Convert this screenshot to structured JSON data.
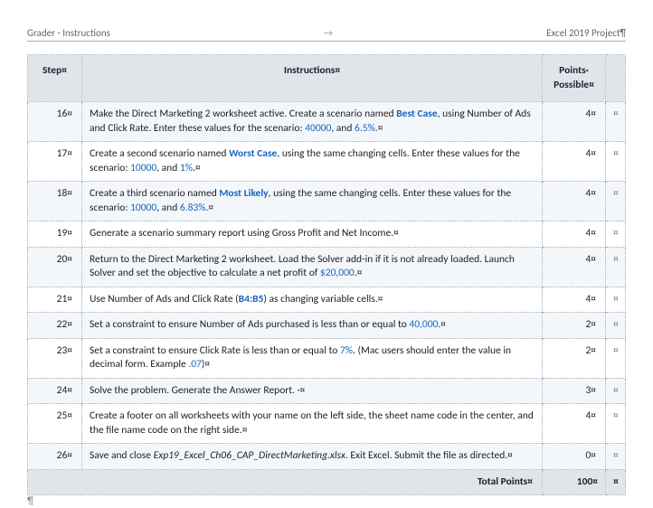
{
  "header": {
    "left": "Grader - Instructions",
    "center": "→",
    "right": "Excel 2019 Project¶"
  },
  "columns": {
    "step": "Step¤",
    "instructions": "Instructions¤",
    "points": "Points·\nPossible¤"
  },
  "marks": {
    "cell": "¤",
    "pilcrow": "¶"
  },
  "rows": [
    {
      "step": "16¤",
      "points": "4¤",
      "segs": [
        {
          "t": "Make the Direct Marketing 2 worksheet active. Create a scenario named "
        },
        {
          "t": "Best Case",
          "cls": "blue"
        },
        {
          "t": ", using Number of Ads and Click Rate. Enter these values for the scenario: "
        },
        {
          "t": "40000",
          "cls": "blue-plain"
        },
        {
          "t": ", and "
        },
        {
          "t": "6.5%",
          "cls": "blue-plain"
        },
        {
          "t": ".¤"
        }
      ]
    },
    {
      "step": "17¤",
      "points": "4¤",
      "segs": [
        {
          "t": "Create a second scenario named "
        },
        {
          "t": "Worst Case",
          "cls": "blue"
        },
        {
          "t": ", using the same changing cells. Enter these values for the scenario: "
        },
        {
          "t": "10000",
          "cls": "blue-plain"
        },
        {
          "t": ", and "
        },
        {
          "t": "1%",
          "cls": "blue-plain"
        },
        {
          "t": ".¤"
        }
      ]
    },
    {
      "step": "18¤",
      "points": "4¤",
      "segs": [
        {
          "t": "Create a third scenario named "
        },
        {
          "t": "Most Likely",
          "cls": "blue"
        },
        {
          "t": ", using the same changing cells. Enter these values for the scenario: "
        },
        {
          "t": "10000",
          "cls": "blue-plain"
        },
        {
          "t": ", and "
        },
        {
          "t": "6.83%",
          "cls": "blue-plain"
        },
        {
          "t": ".¤"
        }
      ]
    },
    {
      "step": "19¤",
      "points": "4¤",
      "segs": [
        {
          "t": "Generate a scenario summary report using Gross Profit and Net Income.¤"
        }
      ]
    },
    {
      "step": "20¤",
      "points": "4¤",
      "segs": [
        {
          "t": "Return to the Direct Marketing 2 worksheet. Load the Solver add-in if it is not already loaded. Launch Solver and set the objective to calculate a net profit of "
        },
        {
          "t": "$20,000",
          "cls": "blue-plain"
        },
        {
          "t": ".¤"
        }
      ]
    },
    {
      "step": "21¤",
      "points": "4¤",
      "segs": [
        {
          "t": "Use Number of Ads and Click Rate ("
        },
        {
          "t": "B4:B5",
          "cls": "blue"
        },
        {
          "t": ") as changing variable cells.¤"
        }
      ]
    },
    {
      "step": "22¤",
      "points": "2¤",
      "segs": [
        {
          "t": "Set a constraint to ensure Number of Ads purchased is less than or equal to "
        },
        {
          "t": "40,000",
          "cls": "blue-plain"
        },
        {
          "t": ".¤"
        }
      ]
    },
    {
      "step": "23¤",
      "points": "2¤",
      "segs": [
        {
          "t": "Set a constraint to ensure Click Rate is less than or equal to "
        },
        {
          "t": "7%",
          "cls": "blue-plain"
        },
        {
          "t": ". (Mac users should enter the value in decimal form. Example "
        },
        {
          "t": ".07",
          "cls": "blue-plain"
        },
        {
          "t": ")¤"
        }
      ]
    },
    {
      "step": "24¤",
      "points": "3¤",
      "segs": [
        {
          "t": "Solve the problem. Generate the Answer Report. ·¤"
        }
      ]
    },
    {
      "step": "25¤",
      "points": "4¤",
      "segs": [
        {
          "t": "Create a footer on all worksheets with your name on the left side, the sheet name code in the center, and the file name code on the right side.¤"
        }
      ]
    },
    {
      "step": "26¤",
      "points": "0¤",
      "segs": [
        {
          "t": "Save and close "
        },
        {
          "t": "Exp19_Excel_Ch06_CAP_DirectMarketing.xlsx",
          "cls": "ital"
        },
        {
          "t": ". Exit Excel. Submit the file as directed.¤"
        }
      ]
    }
  ],
  "total": {
    "label": "Total Points¤",
    "value": "100¤"
  }
}
